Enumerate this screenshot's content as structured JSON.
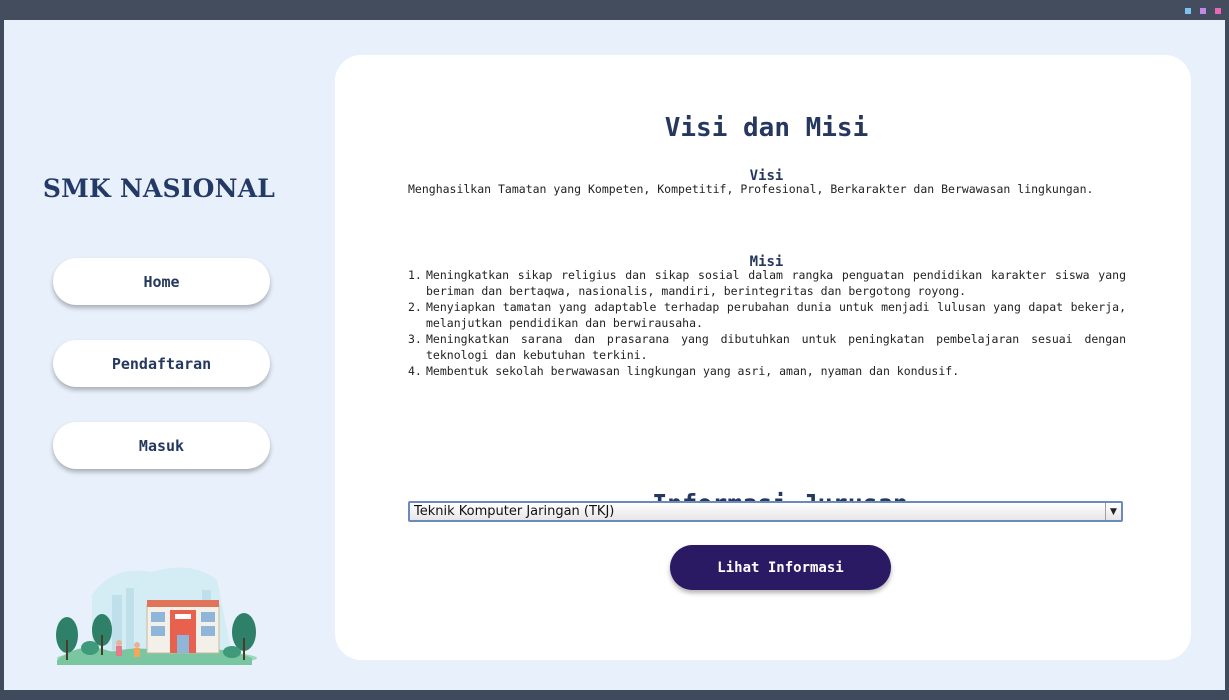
{
  "sidebar": {
    "brand": "SMK NASIONAL",
    "nav": [
      {
        "label": "Home"
      },
      {
        "label": "Pendaftaran"
      },
      {
        "label": "Masuk"
      }
    ]
  },
  "content": {
    "title": "Visi dan Misi",
    "visi_heading": "Visi",
    "visi_text": "Menghasilkan Tamatan yang Kompeten, Kompetitif, Profesional, Berkarakter dan Berwawasan lingkungan.",
    "misi_heading": "Misi",
    "misi": [
      {
        "num": "1.",
        "text": "Meningkatkan sikap religius dan sikap sosial dalam rangka penguatan pendidikan karakter siswa yang beriman dan bertaqwa, nasionalis, mandiri, berintegritas dan bergotong royong."
      },
      {
        "num": "2.",
        "text": "Menyiapkan tamatan yang adaptable terhadap perubahan dunia untuk menjadi lulusan yang dapat bekerja, melanjutkan pendidikan dan berwirausaha."
      },
      {
        "num": "3.",
        "text": "Meningkatkan sarana dan prasarana yang dibutuhkan untuk peningkatan pembelajaran sesuai dengan teknologi dan kebutuhan terkini."
      },
      {
        "num": "4.",
        "text": "Membentuk sekolah berwawasan lingkungan yang asri, aman, nyaman dan kondusif."
      }
    ],
    "info_heading": "Informasi Jurusan",
    "jurusan_select": {
      "value": "Teknik Komputer Jaringan (TKJ)",
      "arrow": "▼"
    },
    "lihat_button": "Lihat Informasi"
  },
  "colors": {
    "window_bg": "#e8f0fb",
    "primary": "#2a1a64",
    "text_dark": "#26385f",
    "dot_blue": "#7ec3f0",
    "dot_purple": "#c08ae6",
    "dot_pink": "#e867b6"
  }
}
